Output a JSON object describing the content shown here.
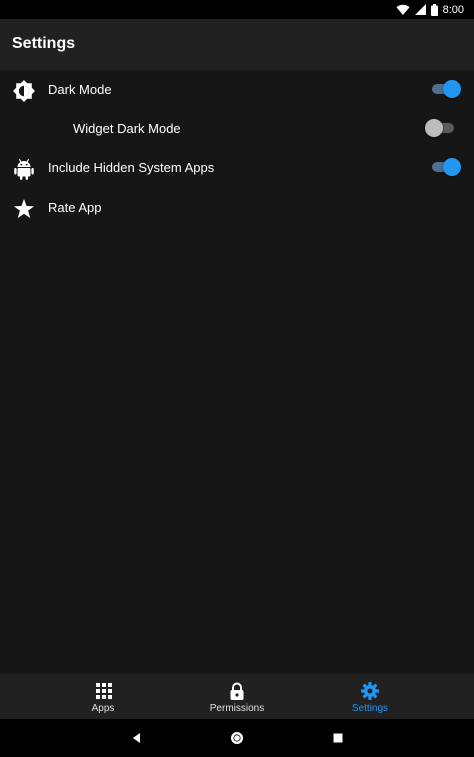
{
  "status_bar": {
    "time": "8:00",
    "icons": [
      "wifi-icon",
      "signal-icon",
      "battery-icon"
    ]
  },
  "app_bar": {
    "title": "Settings"
  },
  "settings": {
    "items": [
      {
        "label": "Dark Mode",
        "icon": "brightness-icon",
        "toggle": true,
        "enabled": true
      },
      {
        "label": "Widget Dark Mode",
        "icon": "",
        "toggle": true,
        "enabled": false
      },
      {
        "label": "Include Hidden System Apps",
        "icon": "android-icon",
        "toggle": true,
        "enabled": true
      },
      {
        "label": "Rate App",
        "icon": "star-icon",
        "toggle": false
      }
    ]
  },
  "bottom_nav": {
    "items": [
      {
        "label": "Apps",
        "icon": "grid-icon",
        "active": false
      },
      {
        "label": "Permissions",
        "icon": "lock-icon",
        "active": false
      },
      {
        "label": "Settings",
        "icon": "gear-icon",
        "active": true
      }
    ]
  },
  "system_nav": {
    "buttons": [
      "back-icon",
      "home-icon",
      "recents-icon"
    ]
  },
  "colors": {
    "accent": "#2196f3",
    "background": "#161616",
    "bar": "#212121"
  }
}
